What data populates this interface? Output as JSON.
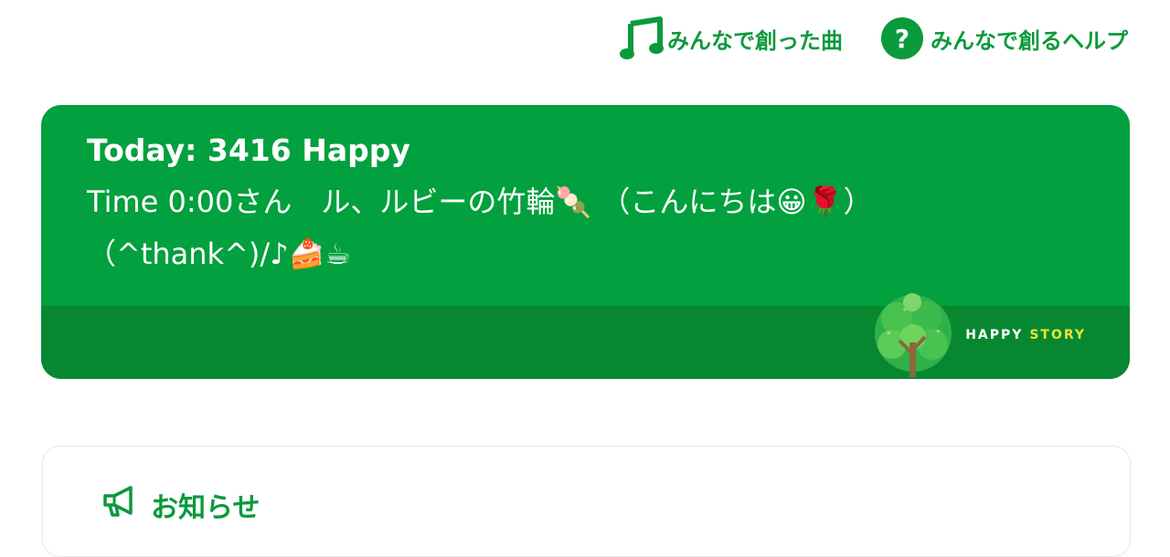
{
  "nav": {
    "songs_label": "みんなで創った曲",
    "help_label": "みんなで創るヘルプ",
    "help_icon_glyph": "?"
  },
  "happy": {
    "title": "Today: 3416 Happy",
    "message": "Time 0:00さん　ル、ルビーの竹輪🍡 （こんにちは😀🌹）\n（^thank^)/♪🍰☕",
    "brand_word1": "HAPPY",
    "brand_word2": "STORY"
  },
  "notice": {
    "heading": "お知らせ"
  },
  "colors": {
    "brand_green": "#0a9a3c",
    "card_green": "#02a03e",
    "card_footer_green": "#078830",
    "brand_accent_yellow": "#e9e33a"
  },
  "icons": {
    "songs": "music-note-icon",
    "help": "question-circle-icon",
    "brand": "tree-logo",
    "notice": "megaphone-icon"
  }
}
